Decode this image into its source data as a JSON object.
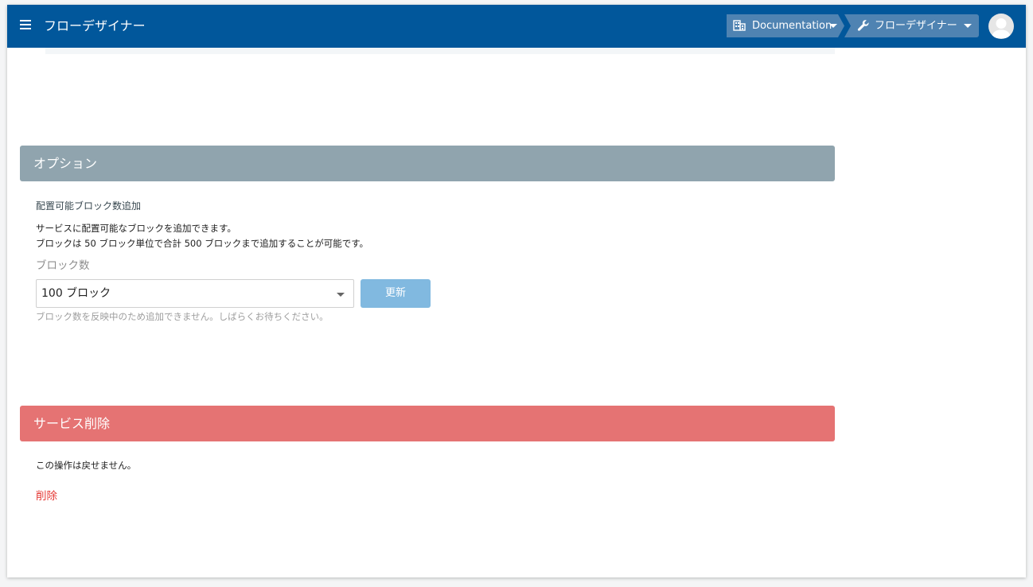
{
  "appbar": {
    "title": "フローデザイナー",
    "menu_icon": "hamburger-menu-icon",
    "breadcrumbs": [
      {
        "label": "Documentation",
        "icon": "building-icon"
      },
      {
        "label": "フローデザイナー",
        "icon": "wrench-icon"
      }
    ],
    "avatar_icon": "user-avatar-icon",
    "bar_color": "#01579b",
    "crumb_color": "#4f83b2"
  },
  "options": {
    "header": "オプション",
    "header_color": "#90a4ae",
    "subheading": "配置可能ブロック数追加",
    "description_lines": [
      "サービスに配置可能なブロックを追加できます。",
      "ブロックは 50 ブロック単位で合計 500 ブロックまで追加することが可能です。"
    ],
    "field_label": "ブロック数",
    "select_value": "100 ブロック",
    "update_button": "更新",
    "update_button_color": "#81b9e0",
    "hint": "ブロック数を反映中のため追加できません。しばらくお待ちください。"
  },
  "delete_section": {
    "header": "サービス削除",
    "header_color": "#e57373",
    "warning": "この操作は戻せません。",
    "delete_link": "削除",
    "link_color": "#e53935"
  }
}
